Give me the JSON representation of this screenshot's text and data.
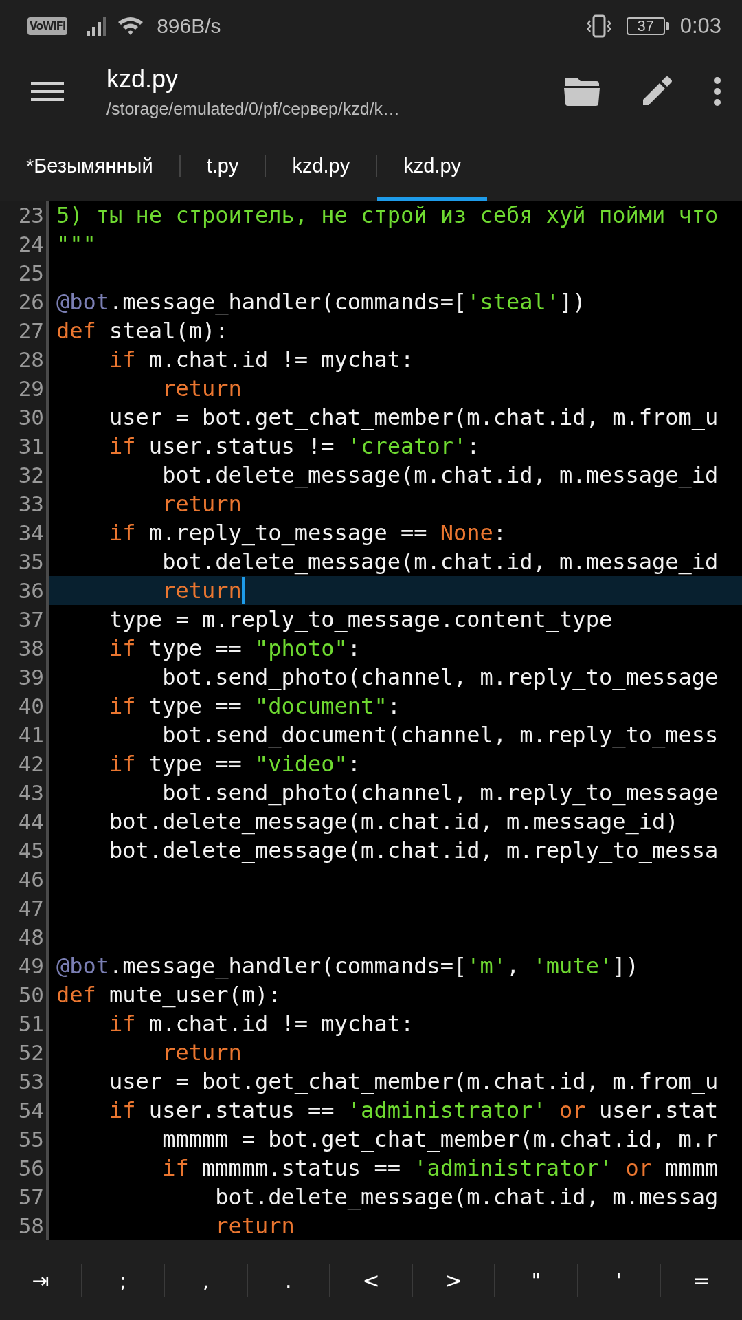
{
  "status_bar": {
    "badge": "VoWiFi",
    "net_speed": "896B/s",
    "battery_text": "37",
    "time": "0:03"
  },
  "toolbar": {
    "title": "kzd.py",
    "subtitle": "/storage/emulated/0/pf/сервер/kzd/k…"
  },
  "tabs": [
    {
      "label": "*Безымянный",
      "selected": false
    },
    {
      "label": "t.py",
      "selected": false
    },
    {
      "label": "kzd.py",
      "selected": false
    },
    {
      "label": "kzd.py",
      "selected": true
    }
  ],
  "editor": {
    "lines": [
      {
        "number": "23",
        "current": false,
        "tokens": [
          {
            "text": "5) ты не строитель, не строй из себя хуй пойми что",
            "kind": "string"
          }
        ]
      },
      {
        "number": "24",
        "current": false,
        "tokens": [
          {
            "text": "\"\"\"",
            "kind": "string"
          }
        ]
      },
      {
        "number": "25",
        "current": false
      },
      {
        "number": "26",
        "current": false,
        "tokens": [
          {
            "text": "@bot",
            "kind": "decorator"
          },
          {
            "text": ".message_handler(commands=[",
            "kind": "plain"
          },
          {
            "text": "'steal'",
            "kind": "string"
          },
          {
            "text": "])",
            "kind": "plain"
          }
        ]
      },
      {
        "number": "27",
        "current": false,
        "tokens": [
          {
            "text": "def",
            "kind": "keyword"
          },
          {
            "text": " steal(m):",
            "kind": "plain"
          }
        ]
      },
      {
        "number": "28",
        "current": false,
        "tokens": [
          {
            "text": "    if",
            "kind": "keyword"
          },
          {
            "text": " m.chat.id != mychat:",
            "kind": "plain"
          }
        ]
      },
      {
        "number": "29",
        "current": false,
        "tokens": [
          {
            "text": "        return",
            "kind": "keyword"
          }
        ]
      },
      {
        "number": "30",
        "current": false,
        "tokens": [
          {
            "text": "    user = bot.get_chat_member(m.chat.id, m.from_u",
            "kind": "plain"
          }
        ]
      },
      {
        "number": "31",
        "current": false,
        "tokens": [
          {
            "text": "    if",
            "kind": "keyword"
          },
          {
            "text": " user.status != ",
            "kind": "plain"
          },
          {
            "text": "'creator'",
            "kind": "string"
          },
          {
            "text": ":",
            "kind": "plain"
          }
        ]
      },
      {
        "number": "32",
        "current": false,
        "tokens": [
          {
            "text": "        bot.delete_message(m.chat.id, m.message_id",
            "kind": "plain"
          }
        ]
      },
      {
        "number": "33",
        "current": false,
        "tokens": [
          {
            "text": "        return",
            "kind": "keyword"
          }
        ]
      },
      {
        "number": "34",
        "current": false,
        "tokens": [
          {
            "text": "    if",
            "kind": "keyword"
          },
          {
            "text": " m.reply_to_message == ",
            "kind": "plain"
          },
          {
            "text": "None",
            "kind": "keyword"
          },
          {
            "text": ":",
            "kind": "plain"
          }
        ]
      },
      {
        "number": "35",
        "current": false,
        "tokens": [
          {
            "text": "        bot.delete_message(m.chat.id, m.message_id",
            "kind": "plain"
          }
        ]
      },
      {
        "number": "36",
        "current": true,
        "tokens": [
          {
            "text": "        return",
            "kind": "keyword"
          }
        ]
      },
      {
        "number": "37",
        "current": false,
        "tokens": [
          {
            "text": "    type = m.reply_to_message.content_type",
            "kind": "plain"
          }
        ]
      },
      {
        "number": "38",
        "current": false,
        "tokens": [
          {
            "text": "    if",
            "kind": "keyword"
          },
          {
            "text": " type == ",
            "kind": "plain"
          },
          {
            "text": "\"photo\"",
            "kind": "string"
          },
          {
            "text": ":",
            "kind": "plain"
          }
        ]
      },
      {
        "number": "39",
        "current": false,
        "tokens": [
          {
            "text": "        bot.send_photo(channel, m.reply_to_message",
            "kind": "plain"
          }
        ]
      },
      {
        "number": "40",
        "current": false,
        "tokens": [
          {
            "text": "    if",
            "kind": "keyword"
          },
          {
            "text": " type == ",
            "kind": "plain"
          },
          {
            "text": "\"document\"",
            "kind": "string"
          },
          {
            "text": ":",
            "kind": "plain"
          }
        ]
      },
      {
        "number": "41",
        "current": false,
        "tokens": [
          {
            "text": "        bot.send_document(channel, m.reply_to_mess",
            "kind": "plain"
          }
        ]
      },
      {
        "number": "42",
        "current": false,
        "tokens": [
          {
            "text": "    if",
            "kind": "keyword"
          },
          {
            "text": " type == ",
            "kind": "plain"
          },
          {
            "text": "\"video\"",
            "kind": "string"
          },
          {
            "text": ":",
            "kind": "plain"
          }
        ]
      },
      {
        "number": "43",
        "current": false,
        "tokens": [
          {
            "text": "        bot.send_photo(channel, m.reply_to_message",
            "kind": "plain"
          }
        ]
      },
      {
        "number": "44",
        "current": false,
        "tokens": [
          {
            "text": "    bot.delete_message(m.chat.id, m.message_id)",
            "kind": "plain"
          }
        ]
      },
      {
        "number": "45",
        "current": false,
        "tokens": [
          {
            "text": "    bot.delete_message(m.chat.id, m.reply_to_messa",
            "kind": "plain"
          }
        ]
      },
      {
        "number": "46",
        "current": false
      },
      {
        "number": "47",
        "current": false
      },
      {
        "number": "48",
        "current": false
      },
      {
        "number": "49",
        "current": false,
        "tokens": [
          {
            "text": "@bot",
            "kind": "decorator"
          },
          {
            "text": ".message_handler(commands=[",
            "kind": "plain"
          },
          {
            "text": "'m'",
            "kind": "string"
          },
          {
            "text": ", ",
            "kind": "plain"
          },
          {
            "text": "'mute'",
            "kind": "string"
          },
          {
            "text": "])",
            "kind": "plain"
          }
        ]
      },
      {
        "number": "50",
        "current": false,
        "tokens": [
          {
            "text": "def",
            "kind": "keyword"
          },
          {
            "text": " mute_user(m):",
            "kind": "plain"
          }
        ]
      },
      {
        "number": "51",
        "current": false,
        "tokens": [
          {
            "text": "    if",
            "kind": "keyword"
          },
          {
            "text": " m.chat.id != mychat:",
            "kind": "plain"
          }
        ]
      },
      {
        "number": "52",
        "current": false,
        "tokens": [
          {
            "text": "        return",
            "kind": "keyword"
          }
        ]
      },
      {
        "number": "53",
        "current": false,
        "tokens": [
          {
            "text": "    user = bot.get_chat_member(m.chat.id, m.from_u",
            "kind": "plain"
          }
        ]
      },
      {
        "number": "54",
        "current": false,
        "tokens": [
          {
            "text": "    if",
            "kind": "keyword"
          },
          {
            "text": " user.status == ",
            "kind": "plain"
          },
          {
            "text": "'administrator'",
            "kind": "string"
          },
          {
            "text": " or",
            "kind": "keyword"
          },
          {
            "text": " user.stat",
            "kind": "plain"
          }
        ]
      },
      {
        "number": "55",
        "current": false,
        "tokens": [
          {
            "text": "        mmmmm = bot.get_chat_member(m.chat.id, m.r",
            "kind": "plain"
          }
        ]
      },
      {
        "number": "56",
        "current": false,
        "tokens": [
          {
            "text": "        if",
            "kind": "keyword"
          },
          {
            "text": " mmmmm.status == ",
            "kind": "plain"
          },
          {
            "text": "'administrator'",
            "kind": "string"
          },
          {
            "text": " or",
            "kind": "keyword"
          },
          {
            "text": " mmmm",
            "kind": "plain"
          }
        ]
      },
      {
        "number": "57",
        "current": false,
        "tokens": [
          {
            "text": "            bot.delete_message(m.chat.id, m.messag",
            "kind": "plain"
          }
        ]
      },
      {
        "number": "58",
        "current": false,
        "tokens": [
          {
            "text": "            return",
            "kind": "keyword"
          }
        ]
      }
    ]
  },
  "keys": [
    "⇥",
    ";",
    ",",
    ".",
    "<",
    ">",
    "\"",
    "'",
    "="
  ]
}
